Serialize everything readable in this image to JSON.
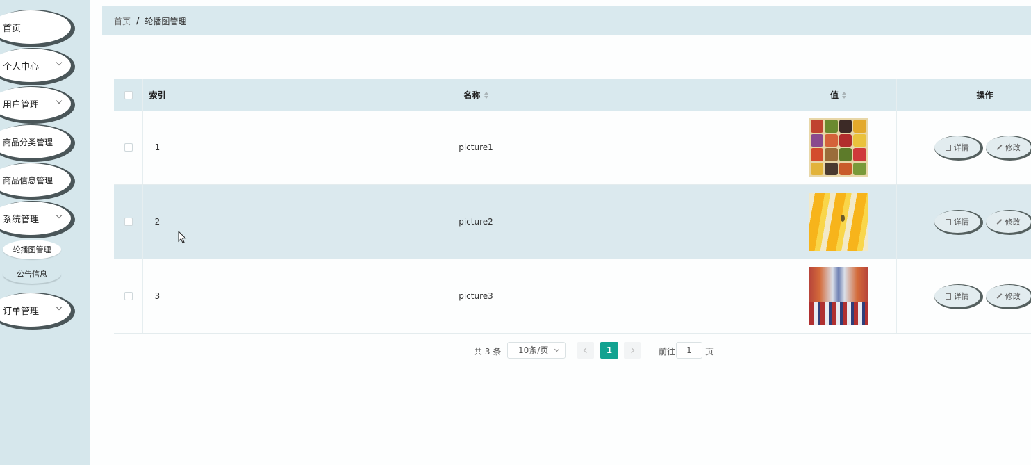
{
  "sidebar": {
    "items": [
      {
        "label": "首页",
        "has_caret": false
      },
      {
        "label": "个人中心",
        "has_caret": true
      },
      {
        "label": "用户管理",
        "has_caret": true
      },
      {
        "label": "商品分类管理",
        "has_caret": true
      },
      {
        "label": "商品信息管理",
        "has_caret": true
      },
      {
        "label": "系统管理",
        "has_caret": true
      },
      {
        "label": "订单管理",
        "has_caret": true
      }
    ],
    "subitems": [
      {
        "label": "轮播图管理",
        "active": true
      },
      {
        "label": "公告信息",
        "active": false
      }
    ]
  },
  "breadcrumb": {
    "home": "首页",
    "separator": "/",
    "current": "轮播图管理"
  },
  "table": {
    "headers": {
      "index": "索引",
      "name": "名称",
      "value": "值",
      "actions": "操作"
    },
    "rows": [
      {
        "index": "1",
        "name": "picture1"
      },
      {
        "index": "2",
        "name": "picture2"
      },
      {
        "index": "3",
        "name": "picture3"
      }
    ],
    "actions": {
      "detail": "详情",
      "edit": "修改"
    }
  },
  "pagination": {
    "total": "共 3 条",
    "page_size": "10条/页",
    "current_page": "1",
    "goto_label": "前往",
    "goto_value": "1",
    "page_unit": "页"
  },
  "colors": {
    "accent": "#11a290",
    "sidebar_bg": "#d6e7ec",
    "header_bg": "#d9e9ee"
  }
}
